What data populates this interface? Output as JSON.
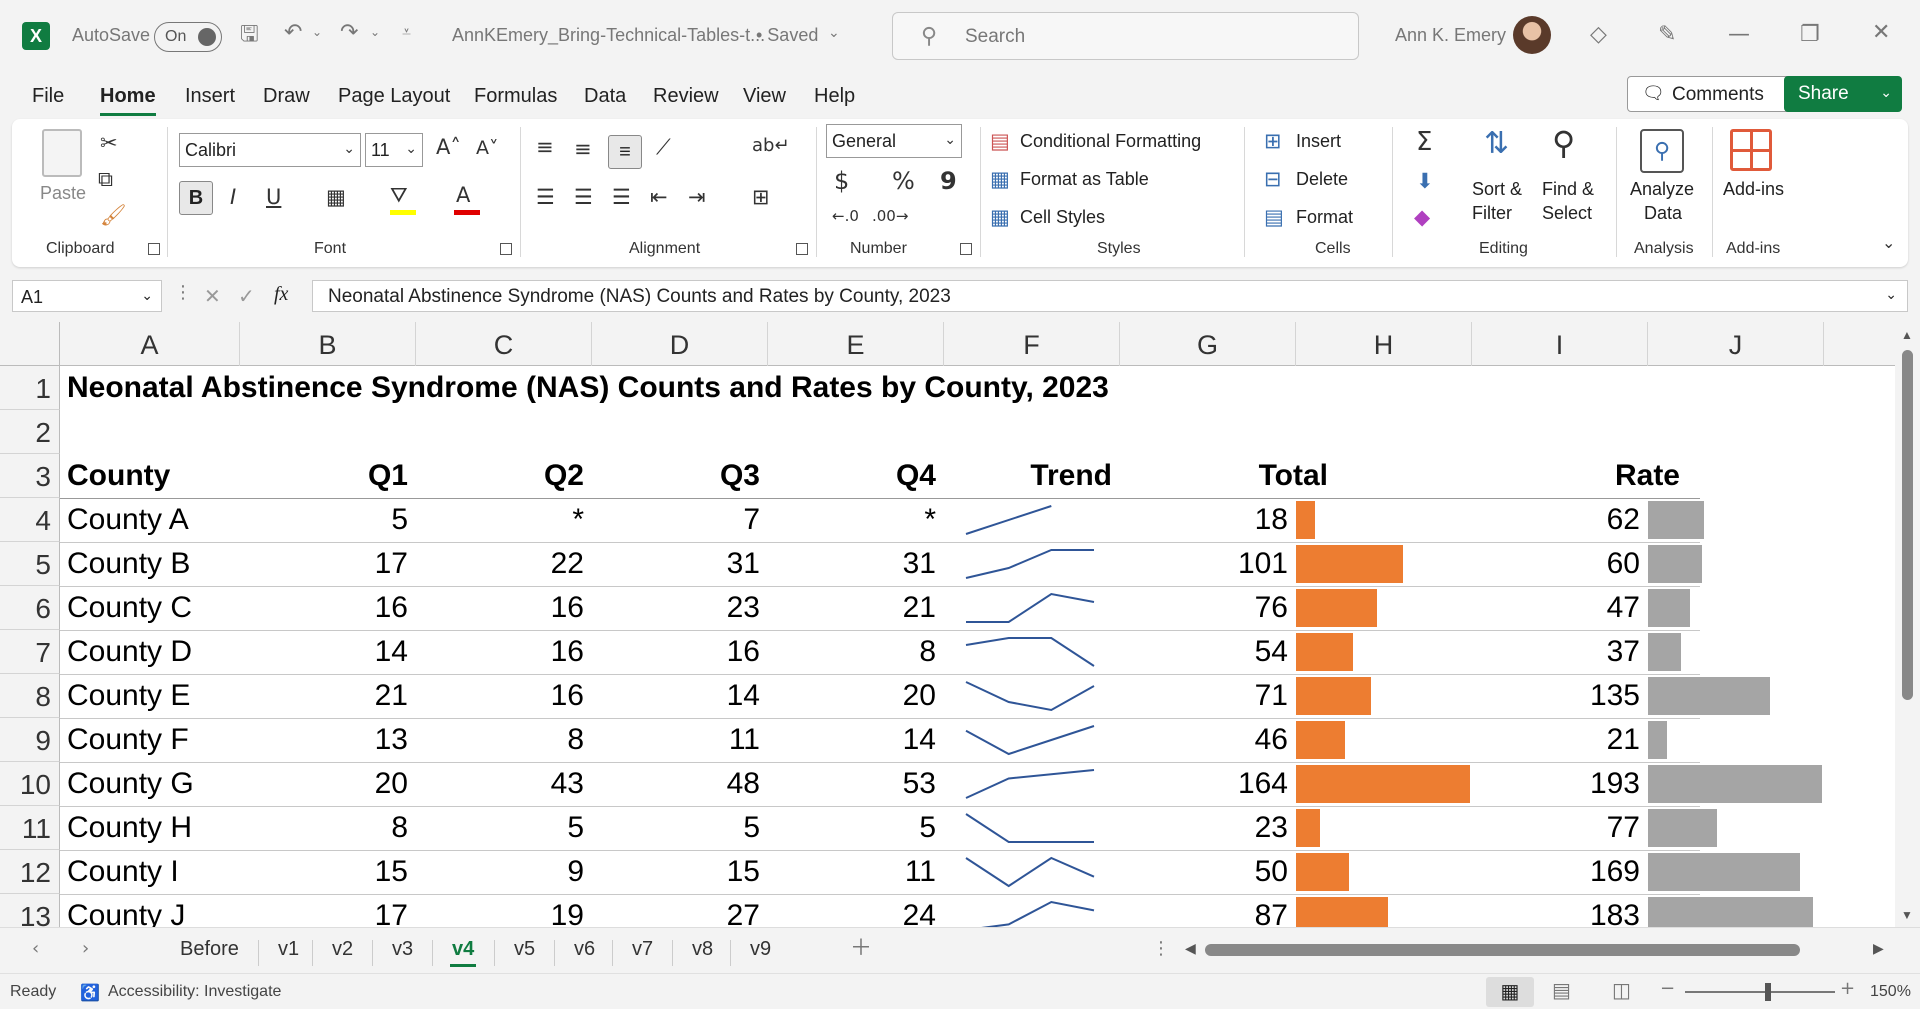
{
  "titlebar": {
    "autosave_label": "AutoSave",
    "autosave_state": "On",
    "filename": "AnnKEmery_Bring-Technical-Tables-t...",
    "save_status": "• Saved",
    "search_placeholder": "Search",
    "user_name": "Ann K. Emery"
  },
  "menu": {
    "items": [
      "File",
      "Home",
      "Insert",
      "Draw",
      "Page Layout",
      "Formulas",
      "Data",
      "Review",
      "View",
      "Help"
    ],
    "comments_label": "Comments",
    "share_label": "Share"
  },
  "ribbon": {
    "clipboard": {
      "paste": "Paste",
      "group": "Clipboard"
    },
    "font": {
      "name": "Calibri",
      "size": "11",
      "bold": "B",
      "italic": "I",
      "underline": "U",
      "group": "Font",
      "grow": "A^",
      "shrink": "Aˇ"
    },
    "alignment": {
      "group": "Alignment"
    },
    "number": {
      "format": "General",
      "currency": "$",
      "percent": "%",
      "comma": "9",
      "group": "Number"
    },
    "styles": {
      "conditional": "Conditional Formatting",
      "format_table": "Format as Table",
      "cell_styles": "Cell Styles",
      "group": "Styles"
    },
    "cells": {
      "insert": "Insert",
      "delete": "Delete",
      "format": "Format",
      "group": "Cells"
    },
    "editing": {
      "sum": "Σ",
      "sort_line1": "Sort &",
      "sort_line2": "Filter",
      "find_line1": "Find &",
      "find_line2": "Select",
      "group": "Editing"
    },
    "analysis": {
      "line1": "Analyze",
      "line2": "Data",
      "group": "Analysis"
    },
    "addins": {
      "label": "Add-ins",
      "group": "Add-ins"
    }
  },
  "formula_bar": {
    "cell_ref": "A1",
    "fx": "fx",
    "content": "Neonatal Abstinence Syndrome (NAS) Counts and Rates by County, 2023"
  },
  "sheet": {
    "columns": [
      "A",
      "B",
      "C",
      "D",
      "E",
      "F",
      "G",
      "H",
      "I",
      "J"
    ],
    "row_numbers": [
      "1",
      "2",
      "3",
      "4",
      "5",
      "6",
      "7",
      "8",
      "9",
      "10",
      "11",
      "12",
      "13"
    ],
    "title": "Neonatal Abstinence Syndrome (NAS) Counts and Rates by County, 2023",
    "headers": {
      "county": "County",
      "q1": "Q1",
      "q2": "Q2",
      "q3": "Q3",
      "q4": "Q4",
      "trend": "Trend",
      "total": "Total",
      "rate": "Rate"
    },
    "rows": [
      {
        "county": "County A",
        "q1": "5",
        "q2": "*",
        "q3": "7",
        "q4": "*",
        "total": "18",
        "rate": "62"
      },
      {
        "county": "County B",
        "q1": "17",
        "q2": "22",
        "q3": "31",
        "q4": "31",
        "total": "101",
        "rate": "60"
      },
      {
        "county": "County C",
        "q1": "16",
        "q2": "16",
        "q3": "23",
        "q4": "21",
        "total": "76",
        "rate": "47"
      },
      {
        "county": "County D",
        "q1": "14",
        "q2": "16",
        "q3": "16",
        "q4": "8",
        "total": "54",
        "rate": "37"
      },
      {
        "county": "County E",
        "q1": "21",
        "q2": "16",
        "q3": "14",
        "q4": "20",
        "total": "71",
        "rate": "135"
      },
      {
        "county": "County F",
        "q1": "13",
        "q2": "8",
        "q3": "11",
        "q4": "14",
        "total": "46",
        "rate": "21"
      },
      {
        "county": "County G",
        "q1": "20",
        "q2": "43",
        "q3": "48",
        "q4": "53",
        "total": "164",
        "rate": "193"
      },
      {
        "county": "County H",
        "q1": "8",
        "q2": "5",
        "q3": "5",
        "q4": "5",
        "total": "23",
        "rate": "77"
      },
      {
        "county": "County I",
        "q1": "15",
        "q2": "9",
        "q3": "15",
        "q4": "11",
        "total": "50",
        "rate": "169"
      },
      {
        "county": "County J",
        "q1": "17",
        "q2": "19",
        "q3": "27",
        "q4": "24",
        "total": "87",
        "rate": "183"
      }
    ],
    "bar_colors": {
      "total": "#ed7d31",
      "rate": "#a5a5a5",
      "sparkline": "#2f5597"
    }
  },
  "sheet_tabs": [
    "Before",
    "v1",
    "v2",
    "v3",
    "v4",
    "v5",
    "v6",
    "v7",
    "v8",
    "v9"
  ],
  "active_tab": "v4",
  "statusbar": {
    "ready": "Ready",
    "accessibility": "Accessibility: Investigate",
    "zoom": "150%"
  }
}
